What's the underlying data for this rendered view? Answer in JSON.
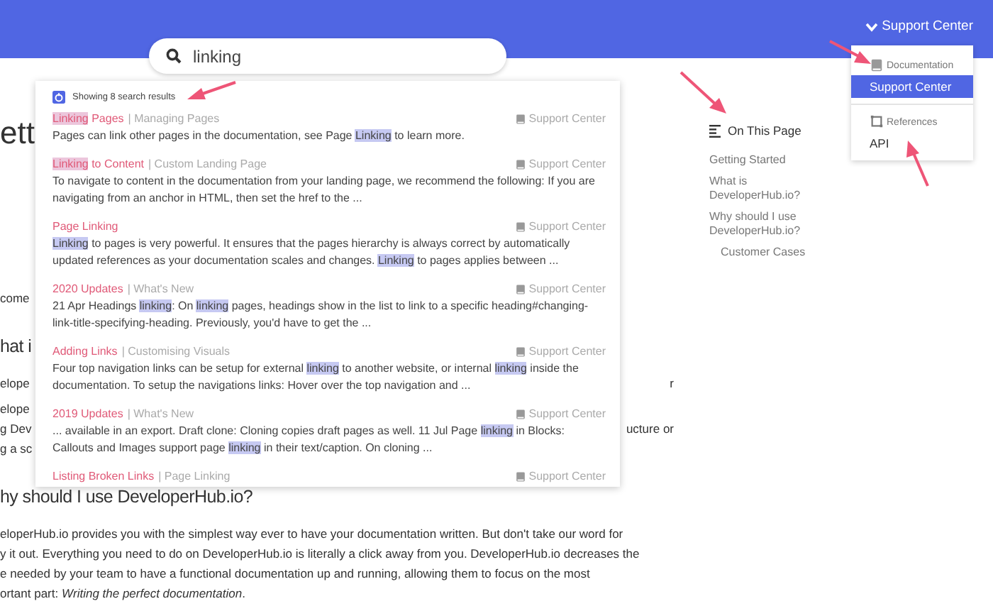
{
  "header": {
    "site_menu": {
      "label": "Support Center",
      "expanded": true
    }
  },
  "search": {
    "value": "linking"
  },
  "nav_menu": {
    "groups": [
      {
        "title": "Documentation",
        "kind": "book",
        "items": [
          {
            "label": "Support Center",
            "selected": true
          }
        ]
      },
      {
        "title": "References",
        "kind": "frame",
        "items": [
          {
            "label": "API",
            "selected": false
          }
        ]
      }
    ]
  },
  "search_results": {
    "summary": "Showing 8 search results",
    "results": [
      {
        "title": [
          {
            "text": "Linking",
            "highlighted": true
          },
          {
            "text": " Pages",
            "highlighted": false
          }
        ],
        "section": "| Managing Pages",
        "source": "Support Center",
        "snippet": [
          {
            "text": "Pages can link other pages in the documentation, see Page ",
            "highlighted": false
          },
          {
            "text": "Linking",
            "highlighted": true
          },
          {
            "text": " to learn more.",
            "highlighted": false
          }
        ]
      },
      {
        "title": [
          {
            "text": "Linking",
            "highlighted": true
          },
          {
            "text": " to Content",
            "highlighted": false
          }
        ],
        "section": "| Custom Landing Page",
        "source": "Support Center",
        "snippet": [
          {
            "text": "To navigate to content in the documentation from your landing page, we recommend the following: If you are navigating from an anchor in HTML, then set the href to the ...",
            "highlighted": false
          }
        ]
      },
      {
        "title": [
          {
            "text": "Page Linking",
            "highlighted": false
          }
        ],
        "source": "Support Center",
        "snippet": [
          {
            "text": "Linking",
            "highlighted": true
          },
          {
            "text": " to pages is very powerful. It ensures that the pages hierarchy is always correct by automatically updated references as your documentation scales and changes. ",
            "highlighted": false
          },
          {
            "text": "Linking",
            "highlighted": true
          },
          {
            "text": " to pages applies between ...",
            "highlighted": false
          }
        ]
      },
      {
        "title": [
          {
            "text": "2020 Updates",
            "highlighted": false
          }
        ],
        "section": "| What's New",
        "source": "Support Center",
        "snippet": [
          {
            "text": "21 Apr Headings ",
            "highlighted": false
          },
          {
            "text": "linking",
            "highlighted": true
          },
          {
            "text": ": On ",
            "highlighted": false
          },
          {
            "text": "linking",
            "highlighted": true
          },
          {
            "text": " pages, headings show in the list to link to a specific heading#changing-link-title-specifying-heading. Previously, you'd have to get the ...",
            "highlighted": false
          }
        ]
      },
      {
        "title": [
          {
            "text": "Adding Links",
            "highlighted": false
          }
        ],
        "section": "| Customising Visuals",
        "source": "Support Center",
        "snippet": [
          {
            "text": "Four top navigation links can be setup for external ",
            "highlighted": false
          },
          {
            "text": "linking",
            "highlighted": true
          },
          {
            "text": " to another website, or internal ",
            "highlighted": false
          },
          {
            "text": "linking",
            "highlighted": true
          },
          {
            "text": " inside the documentation. To setup the navigations links: Hover over the top navigation and ...",
            "highlighted": false
          }
        ]
      },
      {
        "title": [
          {
            "text": "2019 Updates",
            "highlighted": false
          }
        ],
        "section": "| What's New",
        "source": "Support Center",
        "snippet": [
          {
            "text": "... available in an export. Draft clone: Cloning copies draft pages as well. 11 Jul Page ",
            "highlighted": false
          },
          {
            "text": "linking",
            "highlighted": true
          },
          {
            "text": " in Blocks: Callouts and Images support page ",
            "highlighted": false
          },
          {
            "text": "linking",
            "highlighted": true
          },
          {
            "text": " in their text/caption. On cloning ...",
            "highlighted": false
          }
        ]
      },
      {
        "title": [
          {
            "text": "Listing Broken Links",
            "highlighted": false
          }
        ],
        "section": "| Page Linking",
        "source": "Support Center"
      }
    ]
  },
  "on_this_page": {
    "title": "On This Page",
    "items": [
      {
        "label": "Getting Started"
      },
      {
        "label": "What is DeveloperHub.io?"
      },
      {
        "label": "Why should I use DeveloperHub.io?",
        "children": [
          {
            "label": "Customer Cases"
          }
        ]
      }
    ]
  },
  "page": {
    "rows": [
      {
        "kind": "title",
        "left": "ett"
      },
      {
        "kind": "text",
        "left": "come"
      },
      {
        "kind": "heading",
        "left": "hat i"
      },
      {
        "kind": "text",
        "left": "elope",
        "right": "r"
      },
      {
        "kind": "text",
        "left": "elope"
      },
      {
        "kind": "text",
        "left": "g Dev",
        "right": "ucture or"
      },
      {
        "kind": "text",
        "left": "g a sc"
      },
      {
        "kind": "heading",
        "left": "hy should I use DeveloperHub.io?"
      }
    ],
    "paragraph_lines": [
      "eloperHub.io provides you with the simplest way ever to have your documentation written. But don't take our word for",
      "y it out. Everything you need to do on DeveloperHub.io is literally a click away from you. DeveloperHub.io decreases the",
      "e needed by your team to have a functional documentation up and running, allowing them to focus on the most",
      "ortant part: *Writing the perfect documentation*."
    ]
  }
}
